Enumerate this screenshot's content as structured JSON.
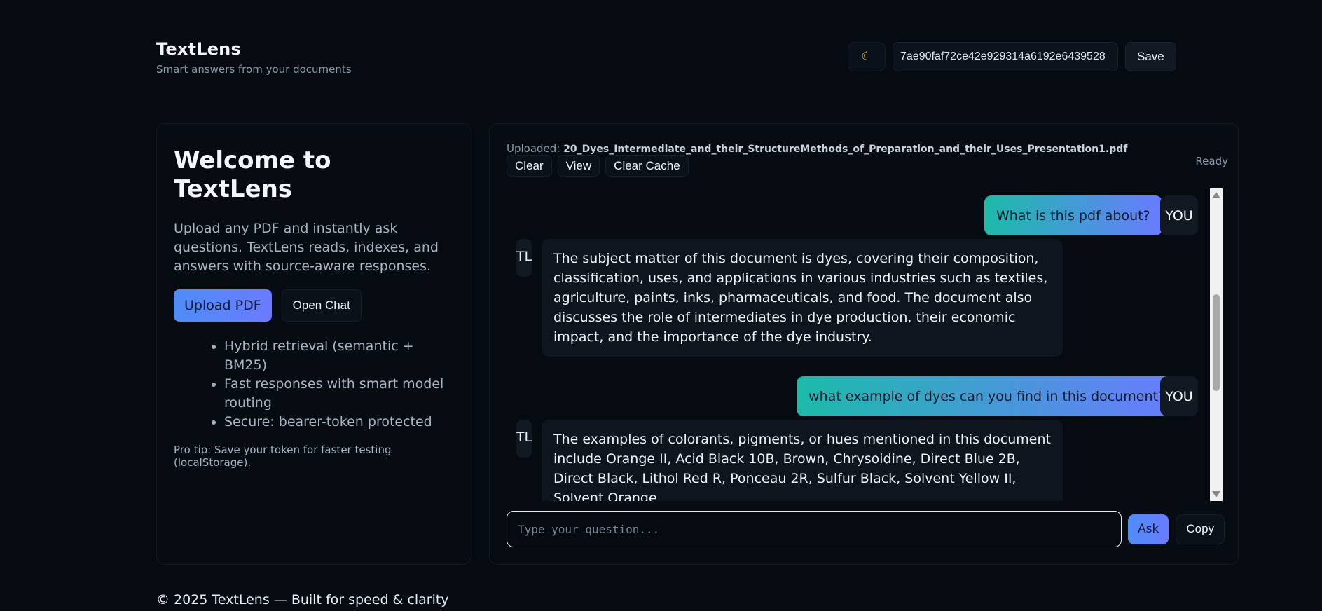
{
  "header": {
    "title": "TextLens",
    "subtitle": "Smart answers from your documents",
    "theme_icon": "moon-icon",
    "token_value": "7ae90faf72ce42e929314a6192e6439528",
    "save_label": "Save"
  },
  "welcome": {
    "title": "Welcome to TextLens",
    "intro": "Upload any PDF and instantly ask questions. TextLens reads, indexes, and answers with source-aware responses.",
    "upload_label": "Upload PDF",
    "open_chat_label": "Open Chat",
    "features": [
      "Hybrid retrieval (semantic + BM25)",
      "Fast responses with smart model routing",
      "Secure: bearer-token protected"
    ],
    "protip": "Pro tip: Save your token for faster testing (localStorage)."
  },
  "chat": {
    "uploaded_label": "Uploaded:",
    "filename": "20_Dyes_Intermediate_and_their_StructureMethods_of_Preparation_and_their_Uses_Presentation1.pdf",
    "status": "Ready",
    "actions": {
      "clear": "Clear",
      "view": "View",
      "clear_cache": "Clear Cache"
    },
    "user_tag": "YOU",
    "bot_tag": "TL",
    "messages": [
      {
        "role": "user",
        "text": "What is this pdf about?"
      },
      {
        "role": "bot",
        "text": "The subject matter of this document is dyes, covering their composition, classification, uses, and applications in various industries such as textiles, agriculture, paints, inks, pharmaceuticals, and food. The document also discusses the role of intermediates in dye production, their economic impact, and the importance of the dye industry."
      },
      {
        "role": "user",
        "text": "what example of dyes can you find in this document?"
      },
      {
        "role": "bot",
        "text": "The examples of colorants, pigments, or hues mentioned in this document include Orange II, Acid Black 10B, Brown, Chrysoidine, Direct Blue 2B, Direct Black, Lithol Red R, Ponceau 2R, Sulfur Black, Solvent Yellow II, Solvent Orange"
      }
    ],
    "input_placeholder": "Type your question...",
    "ask_label": "Ask",
    "copy_label": "Copy"
  },
  "footer": {
    "text": "© 2025 TextLens — Built for speed & clarity"
  }
}
